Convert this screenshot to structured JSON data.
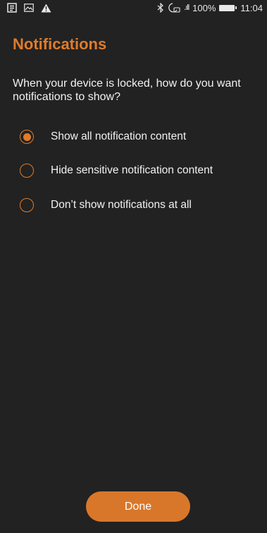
{
  "status_bar": {
    "signal_label": ".ıll",
    "battery_percent": "100%",
    "time": "11:04",
    "left_icons": [
      "news-icon",
      "image-icon",
      "warning-icon"
    ],
    "right_icons": [
      "bluetooth-icon",
      "alarm-icon",
      "signal-icon",
      "battery-icon"
    ]
  },
  "page": {
    "title": "Notifications",
    "prompt": "When your device is locked, how do you want notifications to show?"
  },
  "options": [
    {
      "label": "Show all notification content",
      "selected": true
    },
    {
      "label": "Hide sensitive notification content",
      "selected": false
    },
    {
      "label": "Don’t show notifications at all",
      "selected": false
    }
  ],
  "done_label": "Done",
  "colors": {
    "accent": "#e07b2a",
    "background": "#222222",
    "button": "#d8772a",
    "text": "#f2f2f2"
  }
}
